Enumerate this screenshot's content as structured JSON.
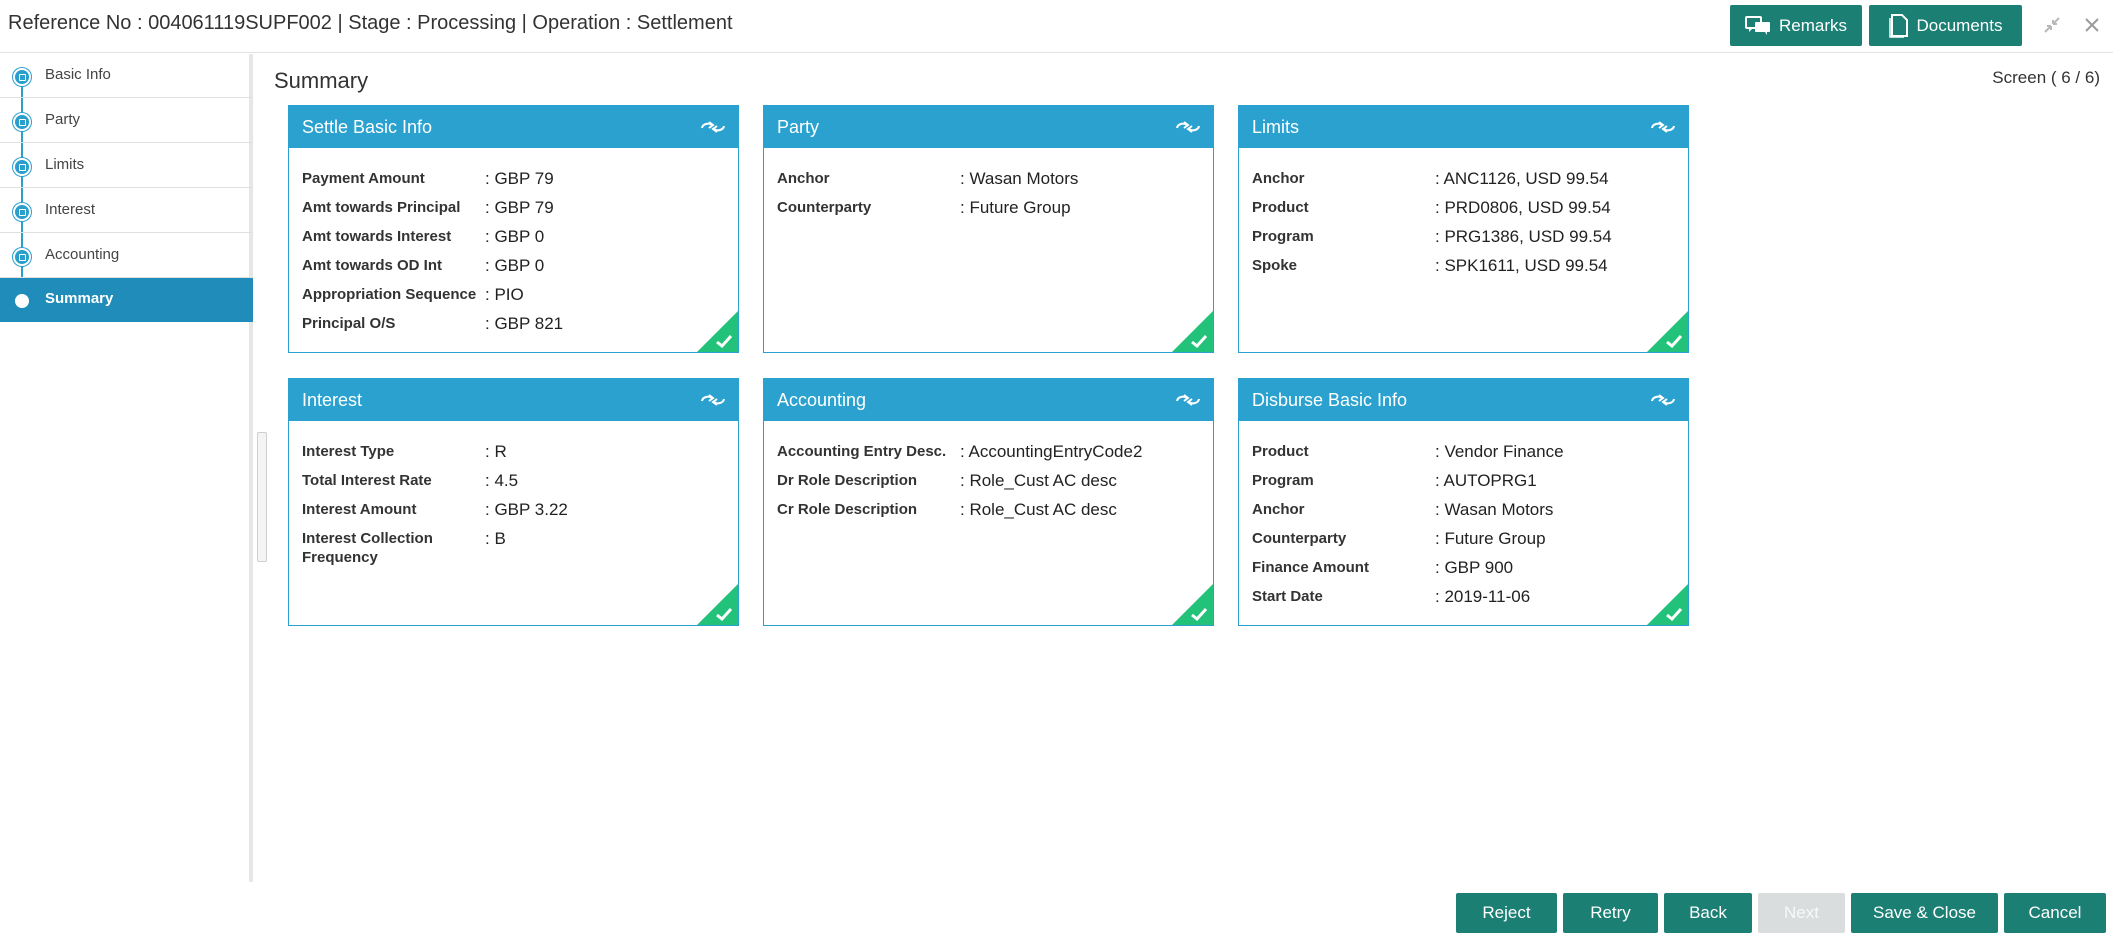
{
  "header": {
    "title": "Reference No : 004061119SUPF002 | Stage : Processing | Operation : Settlement",
    "remarks_label": "Remarks",
    "documents_label": "Documents"
  },
  "sidebar": {
    "items": [
      {
        "label": "Basic Info"
      },
      {
        "label": "Party"
      },
      {
        "label": "Limits"
      },
      {
        "label": "Interest"
      },
      {
        "label": "Accounting"
      },
      {
        "label": "Summary"
      }
    ]
  },
  "main": {
    "title": "Summary",
    "screen_indicator": "Screen ( 6 / 6)"
  },
  "cards": [
    {
      "title": "Settle Basic Info",
      "rows": [
        {
          "label": "Payment Amount",
          "value": ": GBP 79"
        },
        {
          "label": "Amt towards Principal",
          "value": ": GBP 79"
        },
        {
          "label": "Amt towards Interest",
          "value": ": GBP 0"
        },
        {
          "label": "Amt towards OD Int",
          "value": ": GBP 0"
        },
        {
          "label": "Appropriation Sequence",
          "value": ": PIO"
        },
        {
          "label": "Principal O/S",
          "value": ": GBP 821"
        }
      ]
    },
    {
      "title": "Party",
      "rows": [
        {
          "label": "Anchor",
          "value": ": Wasan Motors"
        },
        {
          "label": "Counterparty",
          "value": ": Future Group"
        }
      ]
    },
    {
      "title": "Limits",
      "rows": [
        {
          "label": "Anchor",
          "value": ": ANC1126, USD 99.54"
        },
        {
          "label": "Product",
          "value": ": PRD0806, USD 99.54"
        },
        {
          "label": "Program",
          "value": ": PRG1386, USD 99.54"
        },
        {
          "label": "Spoke",
          "value": ": SPK1611, USD 99.54"
        }
      ]
    },
    {
      "title": "Interest",
      "rows": [
        {
          "label": "Interest Type",
          "value": ": R"
        },
        {
          "label": "Total Interest Rate",
          "value": ": 4.5"
        },
        {
          "label": "Interest Amount",
          "value": ": GBP 3.22"
        },
        {
          "label": "Interest Collection Frequency",
          "value": ": B"
        }
      ]
    },
    {
      "title": "Accounting",
      "rows": [
        {
          "label": "Accounting Entry Desc.",
          "value": ": AccountingEntryCode2"
        },
        {
          "label": "Dr Role Description",
          "value": ": Role_Cust AC desc"
        },
        {
          "label": "Cr Role Description",
          "value": ": Role_Cust AC desc"
        }
      ]
    },
    {
      "title": "Disburse Basic Info",
      "rows": [
        {
          "label": "Product",
          "value": ": Vendor Finance"
        },
        {
          "label": "Program",
          "value": ": AUTOPRG1"
        },
        {
          "label": "Anchor",
          "value": ": Wasan Motors"
        },
        {
          "label": "Counterparty",
          "value": ": Future Group"
        },
        {
          "label": "Finance Amount",
          "value": ": GBP 900"
        },
        {
          "label": "Start Date",
          "value": ": 2019-11-06"
        }
      ]
    }
  ],
  "footer": {
    "reject_label": "Reject",
    "retry_label": "Retry",
    "back_label": "Back",
    "next_label": "Next",
    "save_close_label": "Save & Close",
    "cancel_label": "Cancel"
  },
  "colors": {
    "accent": "#2aa1cf",
    "button": "#1c7f74",
    "check": "#22c27a"
  }
}
